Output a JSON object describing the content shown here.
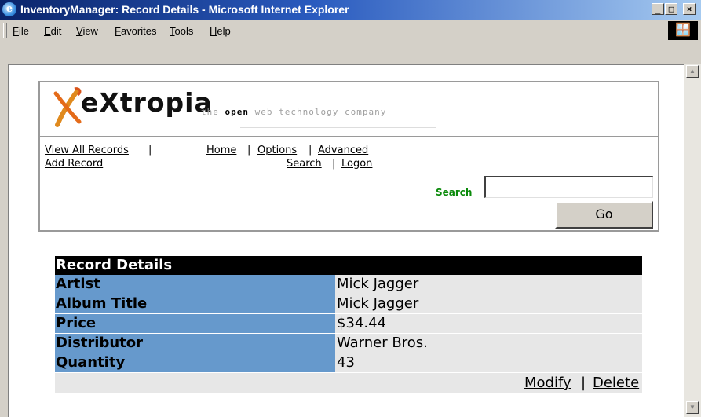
{
  "window": {
    "title": "InventoryManager: Record Details - Microsoft Internet Explorer",
    "controls": {
      "minimize": "_",
      "maximize": "□",
      "close": "×"
    }
  },
  "menu": [
    "File",
    "Edit",
    "View",
    "Favorites",
    "Tools",
    "Help"
  ],
  "site": {
    "logo_text": "eXtropia",
    "tagline_prefix": "the ",
    "tagline_bold": "open",
    "tagline_rest": " web technology company"
  },
  "nav": {
    "view_all": "View All Records",
    "add_record": "Add Record",
    "home": "Home",
    "options": "Options",
    "advanced": "Advanced",
    "search": "Search",
    "logon": "Logon",
    "separator": "|"
  },
  "search": {
    "label": "Search",
    "value": "",
    "placeholder": "",
    "button": "Go"
  },
  "record": {
    "heading": "Record Details",
    "fields": [
      {
        "label": "Artist",
        "value": "Mick Jagger"
      },
      {
        "label": "Album Title",
        "value": "Mick Jagger"
      },
      {
        "label": "Price",
        "value": "$34.44"
      },
      {
        "label": "Distributor",
        "value": "Warner Bros."
      },
      {
        "label": "Quantity",
        "value": "43"
      }
    ],
    "actions": {
      "modify": "Modify",
      "separator": "|",
      "delete": "Delete"
    }
  },
  "colors": {
    "title_bar": "#0a246a",
    "label_cell": "#6699cc",
    "value_cell": "#e7e7e7",
    "search_label": "#0a8a0a"
  }
}
